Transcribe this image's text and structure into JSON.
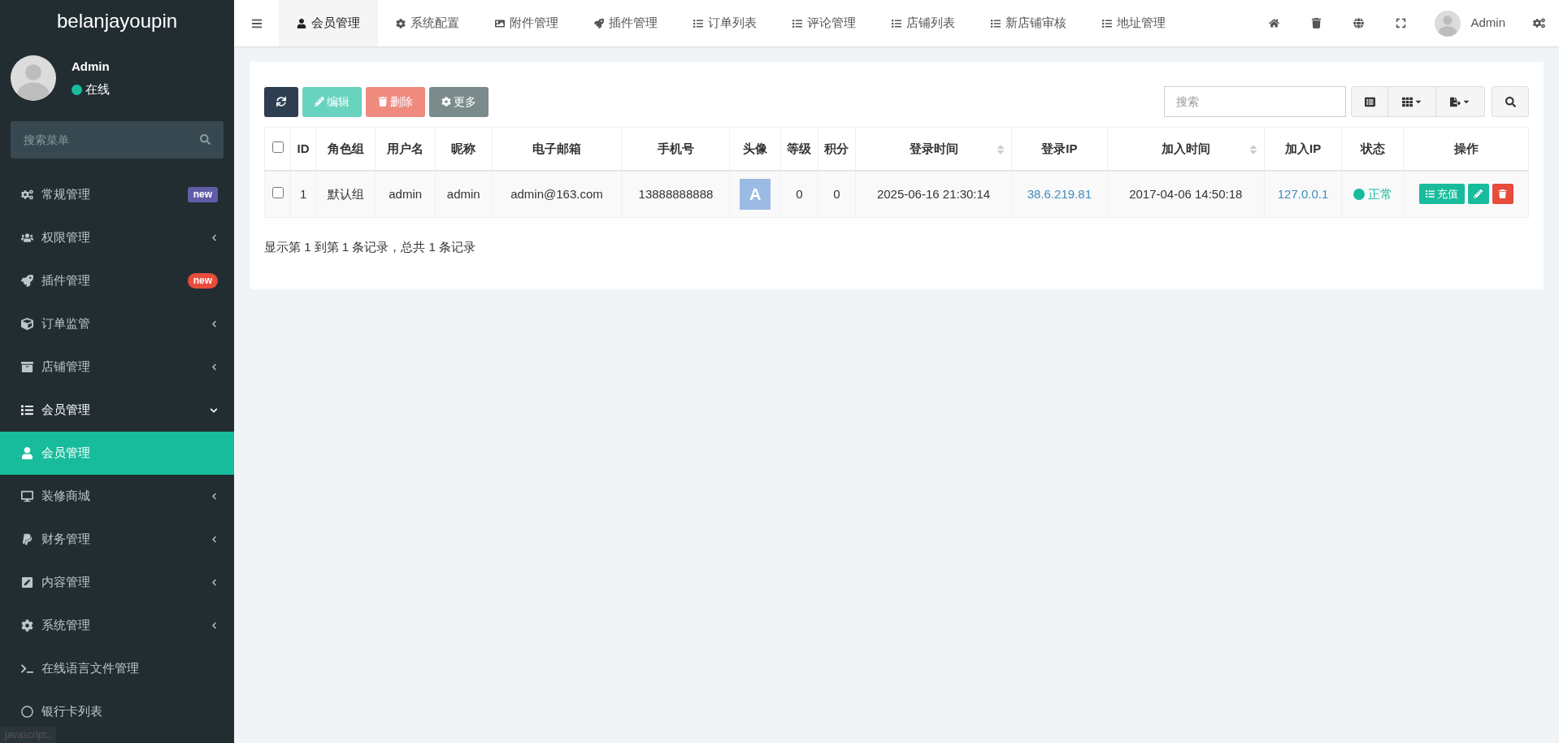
{
  "sidebar": {
    "brand": "belanjayoupin",
    "user": {
      "name": "Admin",
      "status": "在线",
      "online": true
    },
    "search": {
      "placeholder": "搜索菜单"
    },
    "items": [
      {
        "label": "常规管理",
        "badge": {
          "text": "new",
          "color": "#605ca8"
        },
        "selected": false
      },
      {
        "label": "权限管理",
        "expanded": false,
        "selected": false
      },
      {
        "label": "插件管理",
        "badge": {
          "text": "new",
          "color": "#e74c3c"
        },
        "selected": false
      },
      {
        "label": "订单监管",
        "expanded": false,
        "selected": false
      },
      {
        "label": "店铺管理",
        "expanded": false,
        "selected": false
      },
      {
        "label": "会员管理",
        "expanded": true,
        "selected": false,
        "children": [
          {
            "label": "会员管理",
            "selected": true
          }
        ]
      },
      {
        "label": "装修商城",
        "expanded": false,
        "selected": false
      },
      {
        "label": "财务管理",
        "expanded": false,
        "selected": false
      },
      {
        "label": "内容管理",
        "expanded": false,
        "selected": false
      },
      {
        "label": "系统管理",
        "expanded": false,
        "selected": false
      },
      {
        "label": "在线语言文件管理",
        "selected": false
      },
      {
        "label": "银行卡列表",
        "selected": false
      }
    ]
  },
  "tabs": [
    {
      "label": "会员管理",
      "selected": true
    },
    {
      "label": "系统配置",
      "selected": false
    },
    {
      "label": "附件管理",
      "selected": false
    },
    {
      "label": "插件管理",
      "selected": false
    },
    {
      "label": "订单列表",
      "selected": false
    },
    {
      "label": "评论管理",
      "selected": false
    },
    {
      "label": "店铺列表",
      "selected": false
    },
    {
      "label": "新店铺审核",
      "selected": false
    },
    {
      "label": "地址管理",
      "selected": false
    }
  ],
  "header_user": "Admin",
  "toolbar": [
    {
      "kind": "refresh",
      "disabled": false
    },
    {
      "kind": "edit",
      "label": "编辑",
      "disabled": true
    },
    {
      "kind": "delete",
      "label": "删除",
      "disabled": true
    },
    {
      "kind": "more",
      "label": "更多",
      "disabled": false
    }
  ],
  "search": {
    "placeholder": "搜索"
  },
  "table": {
    "columns": [
      {
        "label": "ID",
        "sortable": false
      },
      {
        "label": "角色组",
        "sortable": false
      },
      {
        "label": "用户名",
        "sortable": false
      },
      {
        "label": "昵称",
        "sortable": false
      },
      {
        "label": "电子邮箱",
        "sortable": false
      },
      {
        "label": "手机号",
        "sortable": false
      },
      {
        "label": "头像",
        "sortable": false
      },
      {
        "label": "等级",
        "sortable": false
      },
      {
        "label": "积分",
        "sortable": false
      },
      {
        "label": "登录时间",
        "sortable": true
      },
      {
        "label": "登录IP",
        "sortable": false
      },
      {
        "label": "加入时间",
        "sortable": true
      },
      {
        "label": "加入IP",
        "sortable": false
      },
      {
        "label": "状态",
        "sortable": false
      },
      {
        "label": "操作",
        "sortable": false
      }
    ],
    "header_checked": false,
    "rows": [
      {
        "checked": false,
        "id": "1",
        "group": "默认组",
        "username": "admin",
        "nickname": "admin",
        "email": "admin@163.com",
        "mobile": "13888888888",
        "avatar": "A",
        "level_text": "0",
        "score": "0",
        "login_time": "2025-06-16 21:30:14",
        "login_ip": "38.6.219.81",
        "join_time": "2017-04-06 14:50:18",
        "join_ip": "127.0.0.1",
        "status": {
          "label": "正常",
          "kind": "normal"
        },
        "recharge": "充值"
      }
    ]
  },
  "pagination": "显示第 1 到第 1 条记录，总共 1 条记录",
  "status_bar": "javascript:;"
}
